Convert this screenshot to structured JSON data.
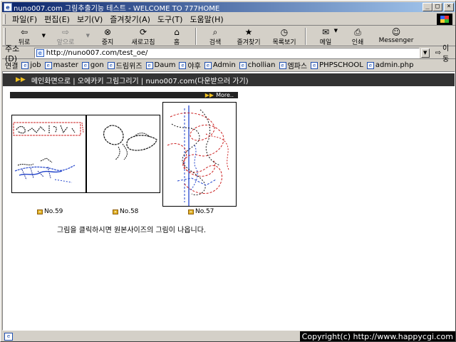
{
  "window": {
    "title": "nuno007.com 그림추출기능 테스트 - WELCOME TO 777HOME",
    "minimize": "_",
    "maximize": "□",
    "close": "×"
  },
  "menu": {
    "items": [
      "파일(F)",
      "편집(E)",
      "보기(V)",
      "즐겨찾기(A)",
      "도구(T)",
      "도움말(H)"
    ]
  },
  "toolbar": {
    "back": "뒤로",
    "forward": "앞으로",
    "stop": "중지",
    "refresh": "새로고침",
    "home": "홈",
    "search": "검색",
    "favorites": "즐겨찾기",
    "history": "목록보기",
    "mail": "메일",
    "print": "인쇄",
    "messenger": "Messenger"
  },
  "address": {
    "label": "주소(D)",
    "url": "http://nuno007.com/test_oe/",
    "go": "이동"
  },
  "links": {
    "label": "연결",
    "items": [
      "job",
      "master",
      "gon",
      "드림위즈",
      "Daum",
      "야후",
      "Admin",
      "chollian",
      "엠파스",
      "PHPSCHOOL",
      "admin.php"
    ]
  },
  "page": {
    "nav_text": "메인화면으로 | 오에카키 그림그리기 | nuno007.com(다운받으러 가기)",
    "more": "More..",
    "thumbnails": [
      {
        "caption": "No.59"
      },
      {
        "caption": "No.58"
      },
      {
        "caption": "No.57"
      }
    ],
    "notice": "그림을 클릭하시면 원본사이즈의 그림이 나옵니다."
  },
  "status": {
    "text": "",
    "copyright": "Copyright(c) http://www.happycgi.com"
  },
  "colors": {
    "titlebar_start": "#0a246a",
    "titlebar_end": "#a6caf0",
    "navbar_bg": "#333333",
    "accent_arrow": "#f0c020"
  }
}
